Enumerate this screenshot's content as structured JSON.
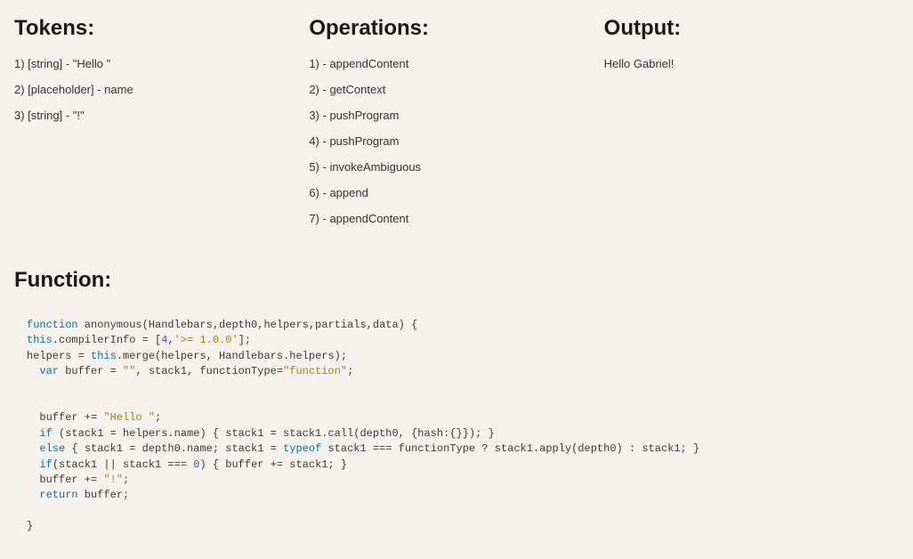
{
  "tokens": {
    "heading": "Tokens:",
    "items": [
      "1) [string] - \"Hello \"",
      "2) [placeholder] - name",
      "3) [string] - \"!\""
    ]
  },
  "operations": {
    "heading": "Operations:",
    "items": [
      "1) - appendContent",
      "2) - getContext",
      "3) - pushProgram",
      "4) - pushProgram",
      "5) - invokeAmbiguous",
      "6) - append",
      "7) - appendContent"
    ]
  },
  "output": {
    "heading": "Output:",
    "text": "Hello Gabriel!"
  },
  "functionSection": {
    "heading": "Function:",
    "code": {
      "line1_kw1": "function",
      "line1_name": " anonymous",
      "line1_args": "(Handlebars,depth0,helpers,partials,data) {",
      "line2a": "this",
      "line2b": ".compilerInfo = [",
      "line2_num": "4",
      "line2c": ",",
      "line2_str": "'>= 1.0.0'",
      "line2d": "];",
      "line3a": "helpers = ",
      "line3_kw": "this",
      "line3b": ".merge(helpers, Handlebars.helpers);",
      "line4_kw": "var",
      "line4a": " buffer = ",
      "line4_str1": "\"\"",
      "line4b": ", stack1, functionType=",
      "line4_str2": "\"function\"",
      "line4c": ";",
      "line5a": "  buffer += ",
      "line5_str": "\"Hello \"",
      "line5b": ";",
      "line6_kw": "if",
      "line6a": " (stack1 = helpers.name) { stack1 = stack1.call(depth0, {hash:{}}); }",
      "line7_kw1": "else",
      "line7a": " { stack1 = depth0.name; stack1 = ",
      "line7_kw2": "typeof",
      "line7b": " stack1 === functionType ? stack1.apply(depth0) : stack1; }",
      "line8_kw": "if",
      "line8a": "(stack1 || stack1 === ",
      "line8_num": "0",
      "line8b": ") { buffer += stack1; }",
      "line9a": "  buffer += ",
      "line9_str": "\"!\"",
      "line9b": ";",
      "line10_kw": "return",
      "line10a": " buffer;",
      "line11": "}"
    }
  }
}
